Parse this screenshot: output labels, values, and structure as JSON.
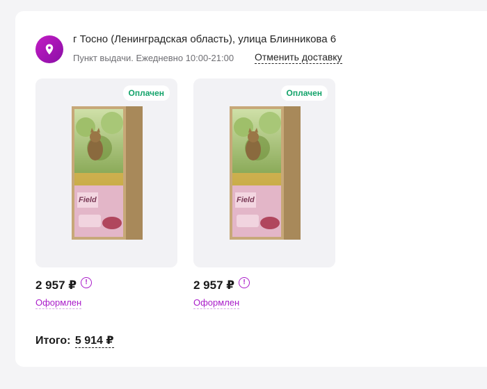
{
  "delivery": {
    "address": "г Тосно (Ленинградская область), улица Блинникова 6",
    "schedule": "Пункт выдачи. Ежедневно 10:00-21:00",
    "cancel_label": "Отменить доставку",
    "pin_icon": "location-pin-icon"
  },
  "items": [
    {
      "badge": "Оплачен",
      "price": "2 957 ₽",
      "status": "Оформлен",
      "image": "cat-food-bag",
      "brand": "Field"
    },
    {
      "badge": "Оплачен",
      "price": "2 957 ₽",
      "status": "Оформлен",
      "image": "cat-food-bag",
      "brand": "Field"
    }
  ],
  "total": {
    "label": "Итого:",
    "value": "5 914 ₽"
  },
  "colors": {
    "accent": "#a91bc9",
    "paid_badge": "#13a36a",
    "pin_gradient_start": "#c21cc4",
    "pin_gradient_end": "#8a0fa6"
  }
}
